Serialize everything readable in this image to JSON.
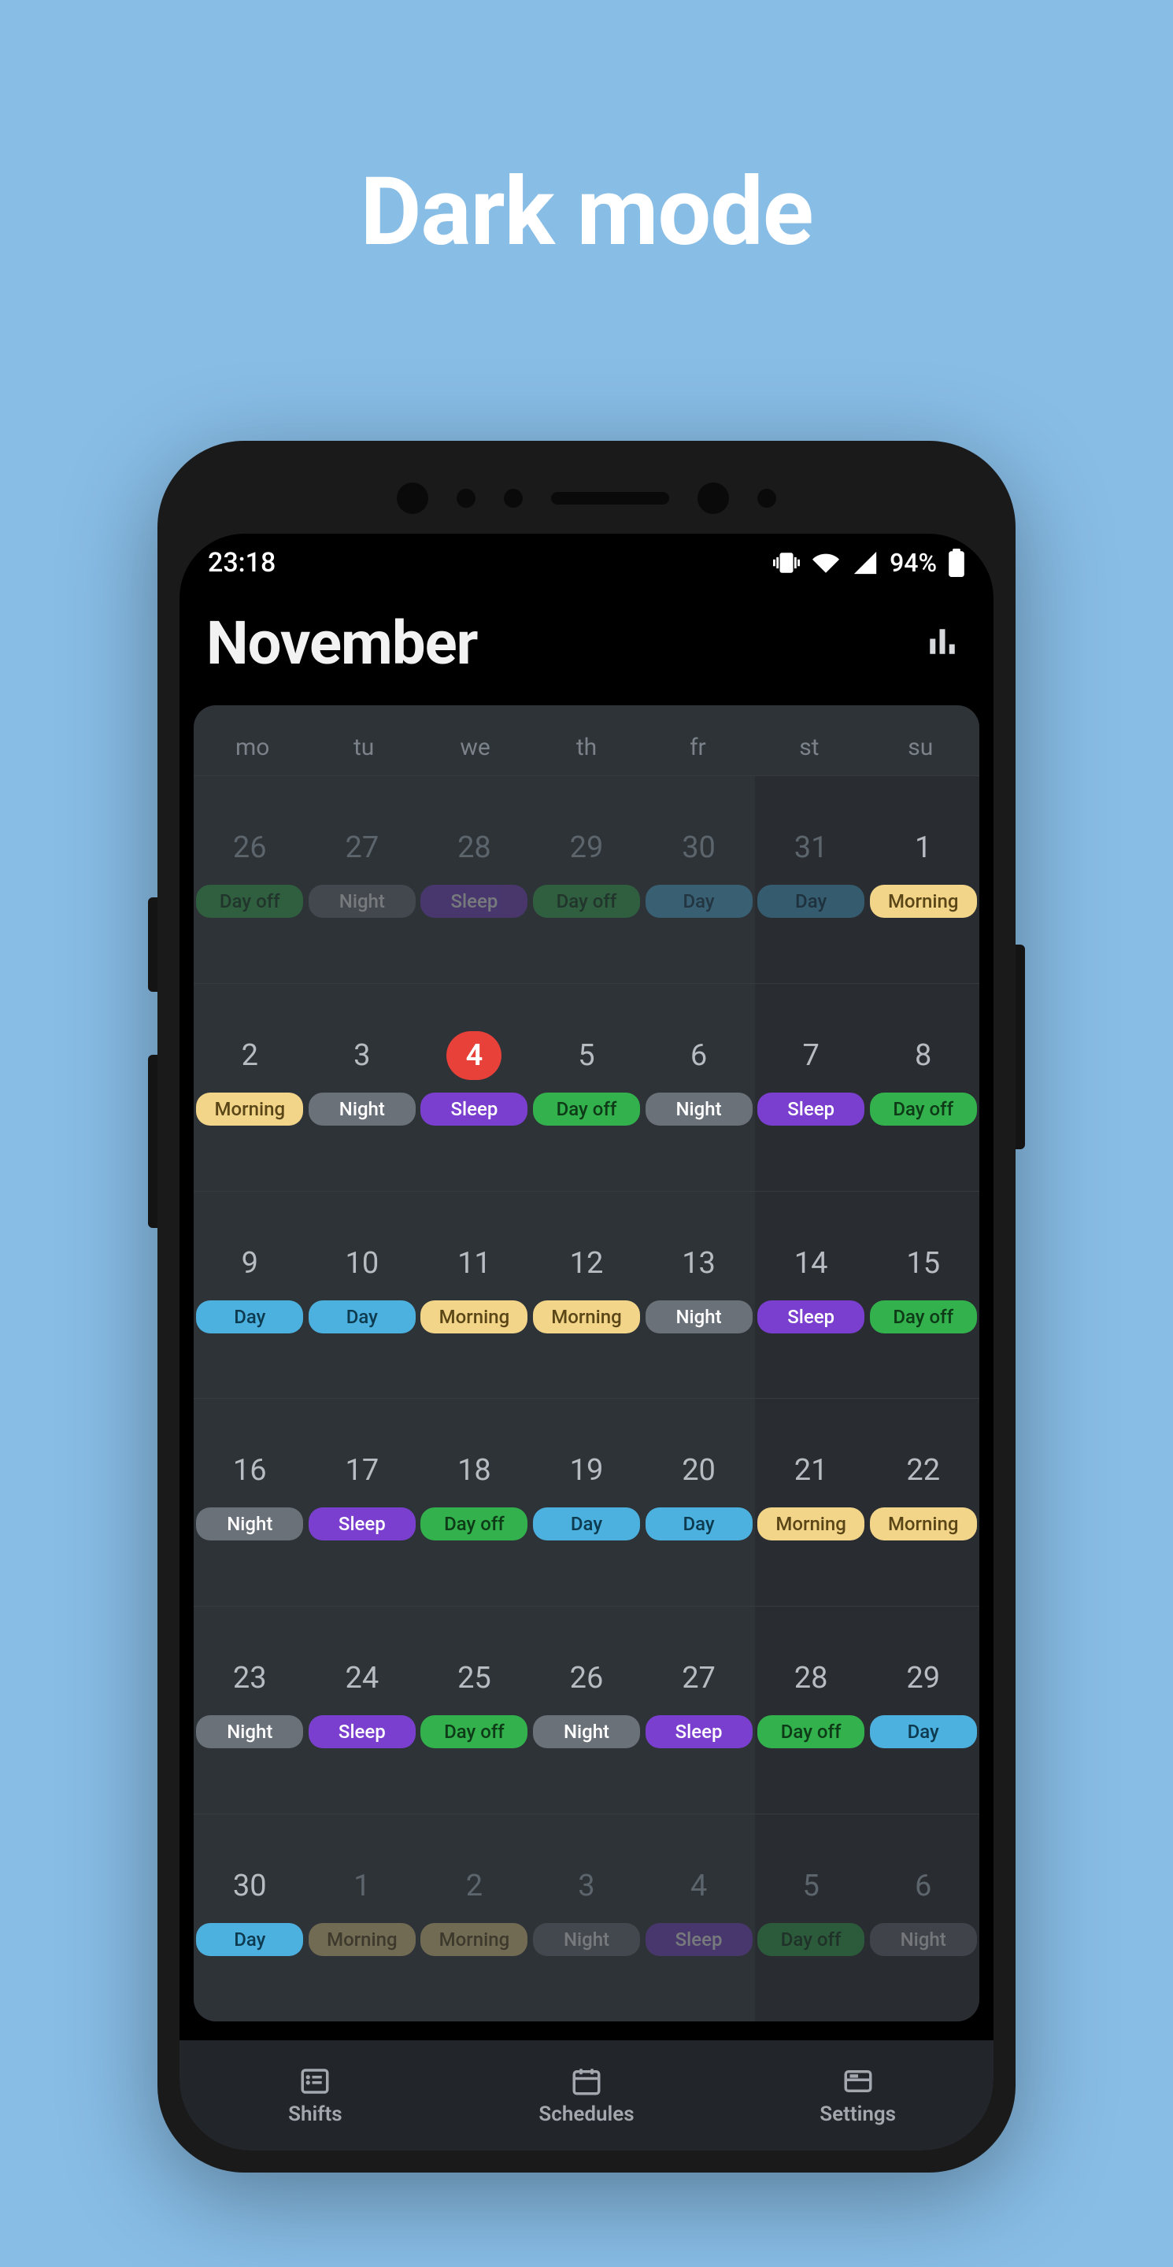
{
  "promo": {
    "title": "Dark mode"
  },
  "status": {
    "time": "23:18",
    "battery": "94%"
  },
  "header": {
    "title": "November"
  },
  "nav": {
    "shifts": "Shifts",
    "schedules": "Schedules",
    "settings": "Settings"
  },
  "weekdays": [
    "mo",
    "tu",
    "we",
    "th",
    "fr",
    "st",
    "su"
  ],
  "shift_colors": {
    "Day off": {
      "bg": "#32b14c",
      "fg": "#0e3a18"
    },
    "Night": {
      "bg": "#6b7179",
      "fg": "#ffffff"
    },
    "Sleep": {
      "bg": "#7a3fce",
      "fg": "#ffffff"
    },
    "Day": {
      "bg": "#4db1df",
      "fg": "#0d3a4f"
    },
    "Morning": {
      "bg": "#f2d589",
      "fg": "#5a4617"
    }
  },
  "weeks": [
    [
      {
        "num": "26",
        "shift": "Day off",
        "outside": true
      },
      {
        "num": "27",
        "shift": "Night",
        "outside": true
      },
      {
        "num": "28",
        "shift": "Sleep",
        "outside": true
      },
      {
        "num": "29",
        "shift": "Day off",
        "outside": true
      },
      {
        "num": "30",
        "shift": "Day",
        "outside": true
      },
      {
        "num": "31",
        "shift": "Day",
        "outside": true
      },
      {
        "num": "1",
        "shift": "Morning"
      }
    ],
    [
      {
        "num": "2",
        "shift": "Morning"
      },
      {
        "num": "3",
        "shift": "Night"
      },
      {
        "num": "4",
        "shift": "Sleep",
        "selected": true
      },
      {
        "num": "5",
        "shift": "Day off"
      },
      {
        "num": "6",
        "shift": "Night"
      },
      {
        "num": "7",
        "shift": "Sleep"
      },
      {
        "num": "8",
        "shift": "Day off"
      }
    ],
    [
      {
        "num": "9",
        "shift": "Day"
      },
      {
        "num": "10",
        "shift": "Day"
      },
      {
        "num": "11",
        "shift": "Morning"
      },
      {
        "num": "12",
        "shift": "Morning"
      },
      {
        "num": "13",
        "shift": "Night"
      },
      {
        "num": "14",
        "shift": "Sleep"
      },
      {
        "num": "15",
        "shift": "Day off"
      }
    ],
    [
      {
        "num": "16",
        "shift": "Night"
      },
      {
        "num": "17",
        "shift": "Sleep"
      },
      {
        "num": "18",
        "shift": "Day off"
      },
      {
        "num": "19",
        "shift": "Day"
      },
      {
        "num": "20",
        "shift": "Day"
      },
      {
        "num": "21",
        "shift": "Morning"
      },
      {
        "num": "22",
        "shift": "Morning"
      }
    ],
    [
      {
        "num": "23",
        "shift": "Night"
      },
      {
        "num": "24",
        "shift": "Sleep"
      },
      {
        "num": "25",
        "shift": "Day off"
      },
      {
        "num": "26",
        "shift": "Night"
      },
      {
        "num": "27",
        "shift": "Sleep"
      },
      {
        "num": "28",
        "shift": "Day off"
      },
      {
        "num": "29",
        "shift": "Day"
      }
    ],
    [
      {
        "num": "30",
        "shift": "Day"
      },
      {
        "num": "1",
        "shift": "Morning",
        "outside": true
      },
      {
        "num": "2",
        "shift": "Morning",
        "outside": true
      },
      {
        "num": "3",
        "shift": "Night",
        "outside": true
      },
      {
        "num": "4",
        "shift": "Sleep",
        "outside": true
      },
      {
        "num": "5",
        "shift": "Day off",
        "outside": true
      },
      {
        "num": "6",
        "shift": "Night",
        "outside": true
      }
    ]
  ]
}
